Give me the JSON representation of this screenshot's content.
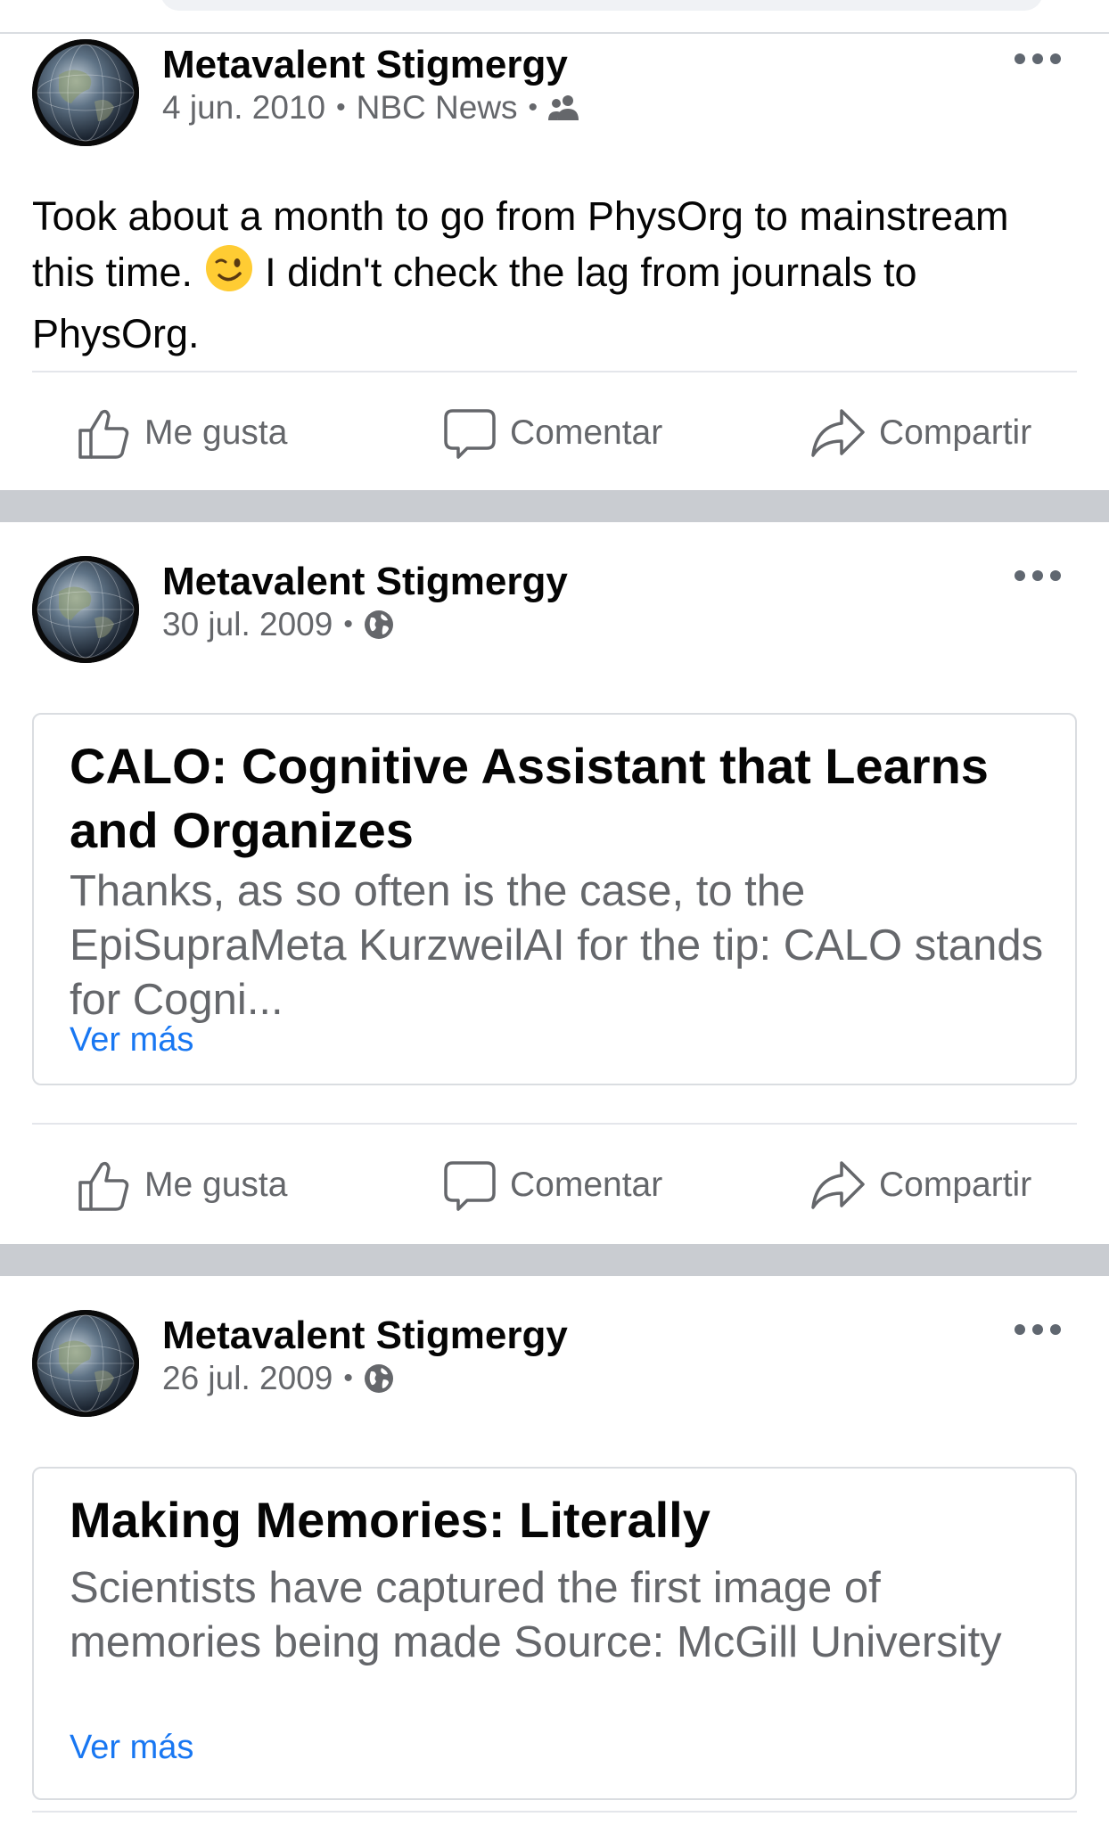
{
  "posts": [
    {
      "author": "Metavalent Stigmergy",
      "date": "4 jun. 2010",
      "source": "NBC News",
      "audience_icon": "friends-icon",
      "text_part1": "Took about a month to go from PhysOrg to mainstream this time.",
      "emoji": "winking-face",
      "text_part2": "I didn't check the lag from journals to PhysOrg."
    },
    {
      "author": "Metavalent Stigmergy",
      "date": "30 jul. 2009",
      "audience_icon": "globe-icon",
      "link_title": "CALO: Cognitive Assistant that Learns and Organizes",
      "link_description": "Thanks, as so often is the case, to the EpiSupraMeta  KurzweilAI  for the tip: CALO stands for Cogni...",
      "see_more": "Ver más"
    },
    {
      "author": "Metavalent Stigmergy",
      "date": "26 jul. 2009",
      "audience_icon": "globe-icon",
      "link_title": "Making Memories: Literally",
      "link_description": "Scientists have captured the first image of memories being made Source:  McGill University",
      "see_more": "Ver más"
    }
  ],
  "actions": {
    "like": "Me gusta",
    "comment": "Comentar",
    "share": "Compartir"
  },
  "colors": {
    "text_primary": "#050505",
    "text_secondary": "#65676b",
    "link_blue": "#1877f2",
    "divider": "#c9ccd1"
  }
}
